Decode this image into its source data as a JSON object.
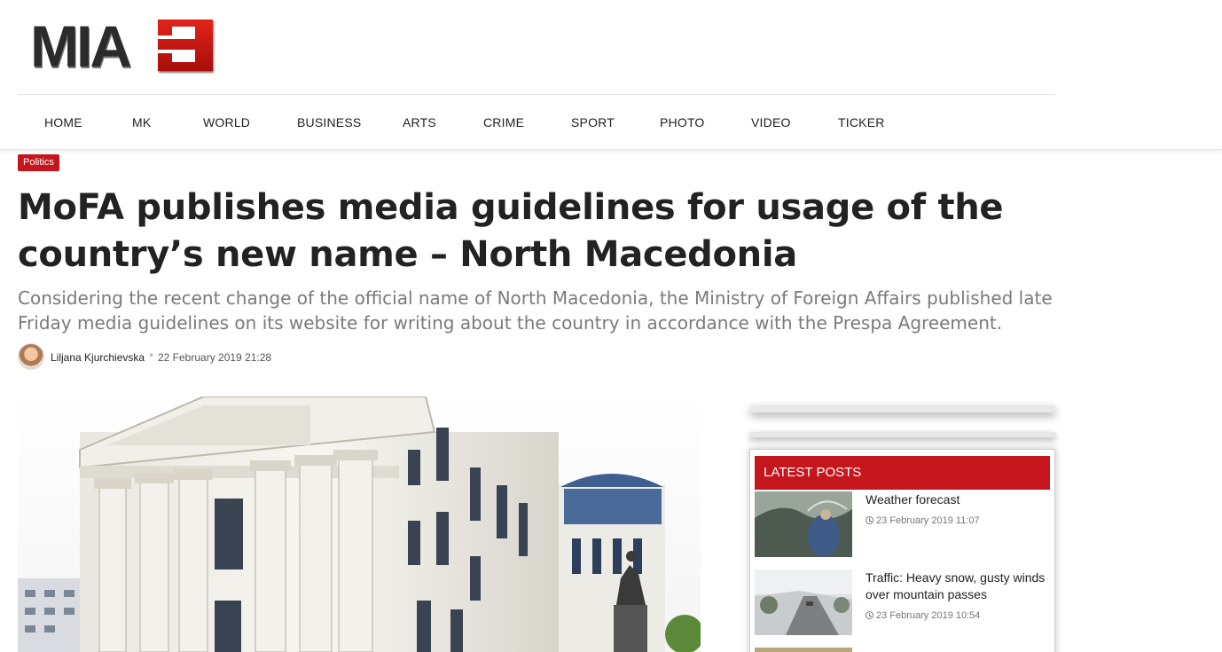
{
  "logo": {
    "text": "MIA"
  },
  "nav": {
    "items": [
      "HOME",
      "MK",
      "WORLD",
      "BUSINESS",
      "ARTS",
      "CRIME",
      "SPORT",
      "PHOTO",
      "VIDEO",
      "TICKER"
    ]
  },
  "article": {
    "category": "Politics",
    "title": "MoFA publishes media guidelines for usage of the country’s new name – North Macedonia",
    "lead": "Considering the recent change of the official name of North Macedonia, the Ministry of Foreign Affairs published late Friday  media guidelines on its website for writing about the country in accordance with the Prespa Agreement.",
    "author": "Liljana Kjurchievska",
    "separator": "•",
    "date": "22 February 2019 21:28"
  },
  "sidebar": {
    "latest_title": "LATEST POSTS",
    "posts": [
      {
        "title": "Weather forecast",
        "date": "23 February 2019 11:07"
      },
      {
        "title": "Traffic: Heavy snow, gusty winds over mountain passes",
        "date": "23 February 2019 10:54"
      }
    ]
  },
  "colors": {
    "brand_red": "#c4161c",
    "text": "#222222",
    "lead": "#7a7a7a"
  },
  "icons": {
    "post_date": "clock-icon"
  }
}
